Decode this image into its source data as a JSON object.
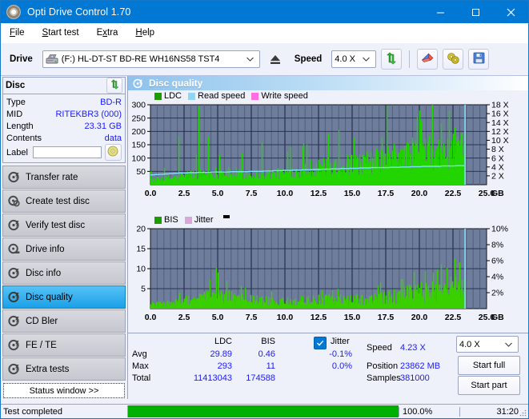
{
  "window": {
    "title": "Opti Drive Control 1.70",
    "app_icon": "disc-icon",
    "minimize": "–",
    "maximize": "☐",
    "close": "✕"
  },
  "menu": {
    "items": [
      {
        "label": "File",
        "accel": "F"
      },
      {
        "label": "Start test",
        "accel": "S"
      },
      {
        "label": "Extra",
        "accel": "x"
      },
      {
        "label": "Help",
        "accel": "H"
      }
    ]
  },
  "toolbar": {
    "drive_label": "Drive",
    "drive_value": "(F:)  HL-DT-ST BD-RE  WH16NS58 TST4",
    "eject_icon": "eject-icon",
    "speed_label": "Speed",
    "speed_value": "4.0 X",
    "refresh_icon": "refresh-icon",
    "erase_icon": "eraser-icon",
    "tools_icon": "cymbals-icon",
    "save_icon": "save-icon",
    "chevron": "⌄"
  },
  "disc_panel": {
    "title": "Disc",
    "refresh_icon": "refresh-icon",
    "rows": [
      {
        "key": "Type",
        "value": "BD-R"
      },
      {
        "key": "MID",
        "value": "RITEKBR3 (000)"
      },
      {
        "key": "Length",
        "value": "23.31 GB"
      },
      {
        "key": "Contents",
        "value": "data"
      }
    ],
    "label_key": "Label",
    "label_value": "",
    "label_placeholder": "",
    "label_button_icon": "disc-icon"
  },
  "sidebar": {
    "items": [
      {
        "label": "Transfer rate",
        "icon": "disc-test-icon",
        "selected": false
      },
      {
        "label": "Create test disc",
        "icon": "disc-write-icon",
        "selected": false
      },
      {
        "label": "Verify test disc",
        "icon": "disc-verify-icon",
        "selected": false
      },
      {
        "label": "Drive info",
        "icon": "drive-info-icon",
        "selected": false
      },
      {
        "label": "Disc info",
        "icon": "disc-info-icon",
        "selected": false
      },
      {
        "label": "Disc quality",
        "icon": "disc-quality-icon",
        "selected": true
      },
      {
        "label": "CD Bler",
        "icon": "disc-bler-icon",
        "selected": false
      },
      {
        "label": "FE / TE",
        "icon": "disc-fete-icon",
        "selected": false
      },
      {
        "label": "Extra tests",
        "icon": "disc-extra-icon",
        "selected": false
      }
    ],
    "status_window_button": "Status window >>"
  },
  "content": {
    "header_title": "Disc quality",
    "header_icon": "disc-quality-icon"
  },
  "stats": {
    "col_ldc": "LDC",
    "col_bis": "BIS",
    "row_avg": "Avg",
    "row_max": "Max",
    "row_total": "Total",
    "ldc_avg": "29.89",
    "ldc_max": "293",
    "ldc_total": "11413043",
    "bis_avg": "0.46",
    "bis_max": "11",
    "bis_total": "174588",
    "jitter_label": "Jitter",
    "jitter_checked": true,
    "jitter_avg": "-0.1%",
    "jitter_max": "0.0%",
    "speed_label": "Speed",
    "speed_value": "4.23 X",
    "position_label": "Position",
    "position_value": "23862 MB",
    "samples_label": "Samples",
    "samples_value": "381000",
    "speed_select": "4.0 X",
    "start_full": "Start full",
    "start_part": "Start part"
  },
  "statusbar": {
    "message": "Test completed",
    "percent": "100.0%",
    "progress": 100,
    "elapsed": "31:20"
  },
  "colors": {
    "accent": "#0078d4",
    "ldc_green": "#22d400",
    "bis_green": "#3ad000",
    "read_speed": "#7fdfff",
    "write_speed": "#ff5ae0",
    "jitter_pink": "#d9a8d9",
    "plot_bg": "#6e7d9c",
    "grid": "#2a3550",
    "value_blue": "#1a1aff",
    "progress_green": "#00b000"
  },
  "chart_data": [
    {
      "type": "area",
      "name": "disc-quality-ldc-chart",
      "title": "",
      "xlabel": "GB",
      "ylabel": "LDC",
      "legend": [
        {
          "label": "LDC",
          "color": "#1c9c00"
        },
        {
          "label": "Read speed",
          "color": "#8fd6f5"
        },
        {
          "label": "Write speed",
          "color": "#ff6ee0"
        }
      ],
      "legend_position": "top-left",
      "grid": true,
      "x": [
        0.0,
        2.5,
        5.0,
        7.5,
        10.0,
        12.5,
        15.0,
        17.5,
        20.0,
        22.5,
        25.0
      ],
      "xlim": [
        0.0,
        25.0
      ],
      "xticklabels": [
        "0.0",
        "2.5",
        "5.0",
        "7.5",
        "10.0",
        "12.5",
        "15.0",
        "17.5",
        "20.0",
        "22.5",
        "25.0"
      ],
      "ylim": [
        0,
        300
      ],
      "yticks": [
        50,
        100,
        150,
        200,
        250,
        300
      ],
      "yticklabels": [
        "50",
        "100",
        "150",
        "200",
        "250",
        "300"
      ],
      "y2lim": [
        0,
        18
      ],
      "y2ticks": [
        2,
        4,
        6,
        8,
        10,
        12,
        14,
        16,
        18
      ],
      "y2ticklabels": [
        "2 X",
        "4 X",
        "6 X",
        "8 X",
        "10 X",
        "12 X",
        "14 X",
        "16 X",
        "18 X"
      ],
      "data_end_gb": 23.4,
      "series": [
        {
          "name": "LDC",
          "color": "#22d400",
          "note": "noisy green area; baseline rises from ~25 to ~200 across disc",
          "envelope_gb": [
            0.0,
            1.0,
            2.0,
            3.0,
            4.0,
            5.0,
            6.0,
            7.0,
            8.0,
            9.0,
            10.0,
            11.0,
            12.0,
            13.0,
            14.0,
            15.0,
            16.0,
            17.0,
            18.0,
            19.0,
            20.0,
            21.0,
            22.0,
            23.0,
            23.4
          ],
          "envelope_values": [
            28,
            32,
            42,
            58,
            62,
            70,
            66,
            60,
            58,
            60,
            66,
            78,
            96,
            104,
            108,
            118,
            126,
            140,
            156,
            168,
            190,
            180,
            186,
            196,
            200
          ],
          "spike_gb": [
            2.1,
            3.6,
            4.3,
            8.3,
            11.6,
            13.2,
            14.0,
            17.2,
            19.8,
            20.0,
            20.1,
            21.6,
            22.6
          ],
          "spike_values": [
            180,
            293,
            180,
            160,
            150,
            190,
            205,
            180,
            255,
            278,
            240,
            230,
            215
          ]
        },
        {
          "name": "Read speed",
          "color": "#7fdfff",
          "axis": "right",
          "x_gb": [
            0.0,
            2.0,
            4.0,
            6.0,
            8.0,
            10.0,
            12.0,
            14.0,
            16.0,
            18.0,
            20.0,
            22.0,
            23.4
          ],
          "values_x": [
            2.2,
            2.6,
            2.8,
            2.9,
            3.0,
            3.2,
            3.4,
            3.6,
            3.8,
            3.9,
            4.1,
            4.2,
            4.3
          ]
        },
        {
          "name": "Write speed",
          "color": "#ff5ae0",
          "axis": "right",
          "x_gb": [],
          "values_x": []
        }
      ],
      "cursor_line_gb": 23.4,
      "cursor_color": "#7fdfff"
    },
    {
      "type": "area",
      "name": "disc-quality-bis-chart",
      "title": "",
      "xlabel": "GB",
      "ylabel": "BIS",
      "legend": [
        {
          "label": "BIS",
          "color": "#1c9c00"
        },
        {
          "label": "Jitter",
          "color": "#d9a8d9"
        }
      ],
      "legend_position": "top-left",
      "grid": true,
      "xlim": [
        0.0,
        25.0
      ],
      "xticklabels": [
        "0.0",
        "2.5",
        "5.0",
        "7.5",
        "10.0",
        "12.5",
        "15.0",
        "17.5",
        "20.0",
        "22.5",
        "25.0"
      ],
      "ylim": [
        0,
        20
      ],
      "yticks": [
        5,
        10,
        15,
        20
      ],
      "yticklabels": [
        "5",
        "10",
        "15",
        "20"
      ],
      "y2lim": [
        0,
        10
      ],
      "y2ticks": [
        2,
        4,
        6,
        8,
        10
      ],
      "y2ticklabels": [
        "2%",
        "4%",
        "6%",
        "8%",
        "10%"
      ],
      "data_end_gb": 23.4,
      "series": [
        {
          "name": "BIS",
          "color": "#3ad000",
          "note": "dense noisy bars",
          "envelope_gb": [
            0.0,
            1.0,
            2.0,
            3.0,
            4.0,
            5.0,
            6.0,
            7.0,
            8.0,
            9.0,
            10.0,
            11.0,
            12.0,
            13.0,
            14.0,
            15.0,
            16.0,
            17.0,
            18.0,
            19.0,
            20.0,
            21.0,
            22.0,
            23.0,
            23.4
          ],
          "envelope_values": [
            1.6,
            1.8,
            2.6,
            3.4,
            4.4,
            5.2,
            4.2,
            3.6,
            3.2,
            2.8,
            2.6,
            3.0,
            3.2,
            3.4,
            3.6,
            3.4,
            3.6,
            4.0,
            4.6,
            5.6,
            6.4,
            6.8,
            7.6,
            8.2,
            8.4
          ],
          "spike_gb": [
            4.9,
            5.0,
            19.6,
            20.4,
            21.0,
            21.6,
            22.0,
            22.6
          ],
          "spike_values": [
            10.2,
            9.0,
            9.2,
            9.4,
            9.0,
            11.0,
            10.2,
            10.0
          ]
        },
        {
          "name": "Jitter",
          "color": "#d9a8d9",
          "axis": "right",
          "x_gb": [],
          "values_x": []
        }
      ],
      "cursor_line_gb": 23.4,
      "cursor_color": "#7fdfff"
    }
  ]
}
